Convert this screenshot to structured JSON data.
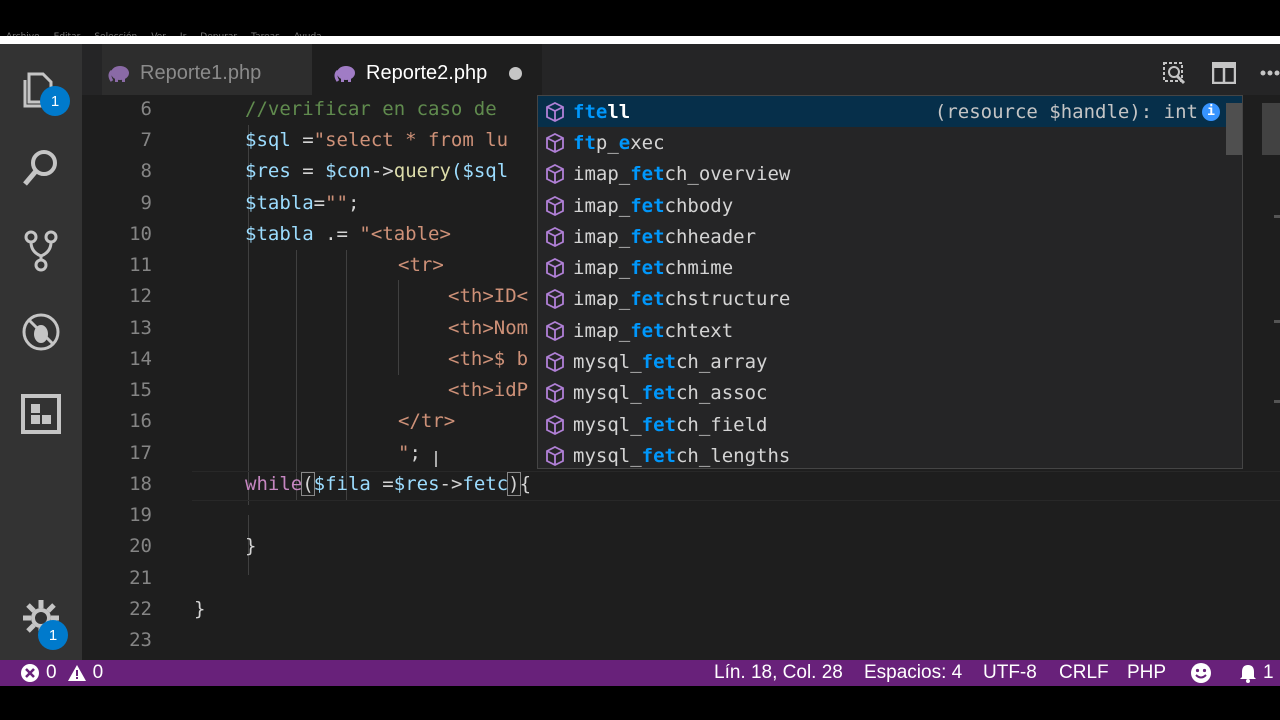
{
  "menubar": [
    "Archivo",
    "Editar",
    "Selección",
    "Ver",
    "Ir",
    "Depurar",
    "Tareas",
    "Ayuda"
  ],
  "activity_bar": {
    "explorer_badge": "1",
    "settings_badge": "1"
  },
  "tabs": [
    {
      "label": "Reporte1.php",
      "active": false
    },
    {
      "label": "Reporte2.php",
      "active": true,
      "dirty": true
    }
  ],
  "editor": {
    "line_numbers": [
      "6",
      "7",
      "8",
      "9",
      "10",
      "11",
      "12",
      "13",
      "14",
      "15",
      "16",
      "17",
      "18",
      "19",
      "20",
      "21",
      "22",
      "23"
    ],
    "lines": {
      "l6": "//verificar en caso de",
      "l7_var": "$sql",
      "l7_op": " =",
      "l7_str": "\"select * from lu",
      "l8_var": "$res",
      "l8_op": " = ",
      "l8_var2": "$con",
      "l8_arrow": "->",
      "l8_fn": "query",
      "l8_rest": "($sql",
      "l9_var": "$tabla",
      "l9_op": "=",
      "l9_str": "\"\"",
      "l9_end": ";",
      "l10_var": "$tabla",
      "l10_op": " .= ",
      "l10_str": "\"<table>",
      "l11": "<tr>",
      "l12": "<th>ID<",
      "l13": "<th>Nom",
      "l14": "<th>$ b",
      "l15": "<th>idP",
      "l16": "</tr>",
      "l17_str": "\"",
      "l17_end": ";",
      "l18_kw": "while",
      "l18_p1": "(",
      "l18_var": "$fila",
      "l18_op": " =",
      "l18_var2": "$res",
      "l18_arrow": "->",
      "l18_fn": "fetc",
      "l18_p2": ")",
      "l18_brace": "{",
      "l20": "}",
      "l22": "}"
    }
  },
  "suggestions": {
    "items": [
      {
        "hl": "fte",
        "rest": "ll",
        "prefix": "",
        "selected": true,
        "detail": "(resource $handle): int"
      },
      {
        "prefix": "",
        "hl": "ft",
        "mid": "p_",
        "hl2": "e",
        "rest": "xec"
      },
      {
        "prefix": "imap_",
        "hl": "fet",
        "rest": "ch_overview"
      },
      {
        "prefix": "imap_",
        "hl": "fet",
        "rest": "chbody"
      },
      {
        "prefix": "imap_",
        "hl": "fet",
        "rest": "chheader"
      },
      {
        "prefix": "imap_",
        "hl": "fet",
        "rest": "chmime"
      },
      {
        "prefix": "imap_",
        "hl": "fet",
        "rest": "chstructure"
      },
      {
        "prefix": "imap_",
        "hl": "fet",
        "rest": "chtext"
      },
      {
        "prefix": "mysql_",
        "hl": "fet",
        "rest": "ch_array"
      },
      {
        "prefix": "mysql_",
        "hl": "fet",
        "rest": "ch_assoc"
      },
      {
        "prefix": "mysql_",
        "hl": "fet",
        "rest": "ch_field"
      },
      {
        "prefix": "mysql_",
        "hl": "fet",
        "rest": "ch_lengths"
      }
    ],
    "info_icon": "i"
  },
  "statusbar": {
    "errors": "0",
    "warnings": "0",
    "position": "Lín. 18, Col. 28",
    "spaces": "Espacios: 4",
    "encoding": "UTF-8",
    "eol": "CRLF",
    "language": "PHP",
    "notifications": "1"
  },
  "colors": {
    "statusbar": "#68217a",
    "badge": "#007acc",
    "highlight": "#0097fb"
  }
}
